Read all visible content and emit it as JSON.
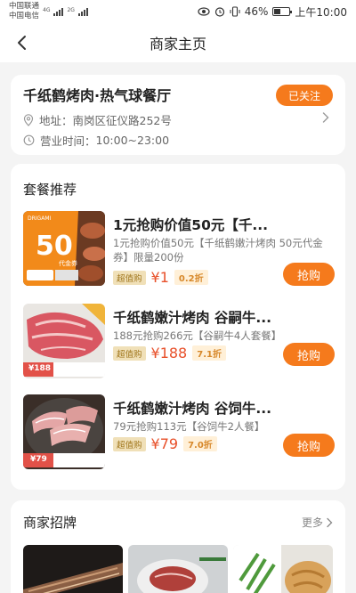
{
  "status_bar": {
    "carrier_1": "中国联通",
    "carrier_2": "中国电信",
    "net_1": "4G",
    "net_2": "2G",
    "battery": "46%",
    "battery_level": 0.46,
    "time": "上午10:00"
  },
  "nav": {
    "title": "商家主页"
  },
  "shop": {
    "name": "千纸鹤烤肉·热气球餐厅",
    "follow_label": "已关注",
    "address_label": "地址：",
    "address": "南岗区征仪路252号",
    "hours_label": "营业时间：",
    "hours": "10:00~23:00"
  },
  "packages": {
    "title": "套餐推荐",
    "items": [
      {
        "title": "1元抢购价值50元【千...",
        "desc": "1元抢购价值50元【千纸鹤嫩汁烤肉 50元代金券】限量200份",
        "value_badge": "超值购",
        "price": "¥1",
        "discount": "0.2折",
        "buy_label": "抢购",
        "img_big": "50",
        "img_sub": "代金券",
        "img_tag": "DRIGAMI"
      },
      {
        "title": "千纸鹤嫩汁烤肉 谷嗣牛...",
        "desc": "188元抢购266元【谷嗣牛4人套餐】",
        "value_badge": "超值购",
        "price": "¥188",
        "discount": "7.1折",
        "buy_label": "抢购",
        "img_tag": "¥188"
      },
      {
        "title": "千纸鹤嫩汁烤肉 谷饲牛...",
        "desc": "79元抢购113元【谷饲牛2人餐】",
        "value_badge": "超值购",
        "price": "¥79",
        "discount": "7.0折",
        "buy_label": "抢购",
        "img_tag": "¥79"
      }
    ]
  },
  "signature": {
    "title": "商家招牌",
    "more_label": "更多"
  },
  "colors": {
    "accent": "#f57a1c",
    "price": "#e8502a",
    "badge_bg": "#f0e0b8"
  },
  "icons": [
    "back-arrow-icon",
    "location-pin-icon",
    "clock-icon",
    "chevron-right-icon",
    "eye-icon",
    "alarm-icon",
    "vibrate-icon",
    "battery-icon",
    "signal-icon"
  ]
}
